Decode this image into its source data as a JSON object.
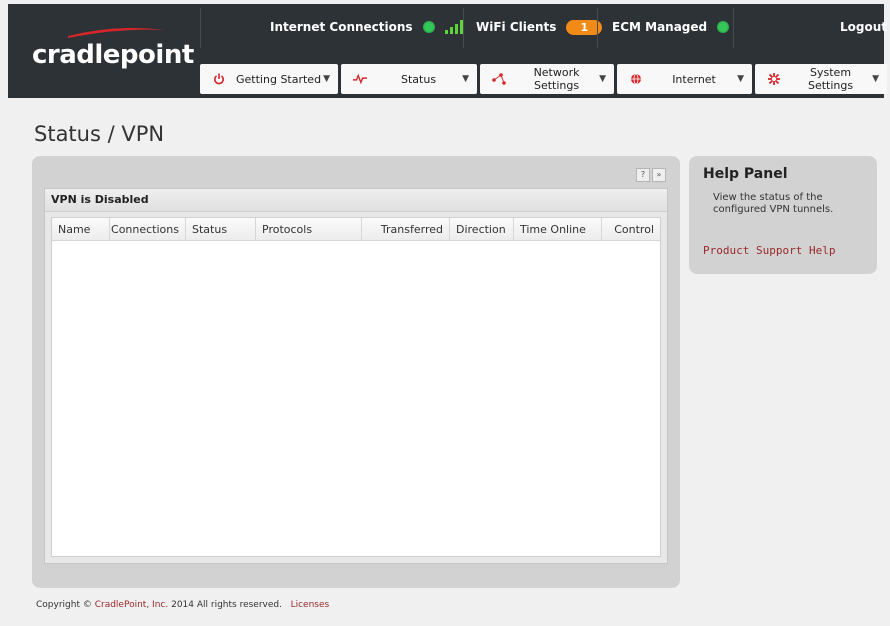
{
  "header": {
    "logo_text": "cradlepoint",
    "internet_connections_label": "Internet Connections",
    "wifi_clients_label": "WiFi Clients",
    "wifi_clients_count": "1",
    "ecm_managed_label": "ECM Managed",
    "logout_label": "Logout",
    "status_color": "#34c759",
    "badge_color": "#f28a18"
  },
  "nav": {
    "tabs": [
      {
        "label": "Getting Started",
        "icon": "power-icon"
      },
      {
        "label": "Status",
        "icon": "pulse-icon"
      },
      {
        "label": "Network Settings",
        "icon": "network-icon"
      },
      {
        "label": "Internet",
        "icon": "globe-icon"
      },
      {
        "label": "System Settings",
        "icon": "gear-icon"
      }
    ]
  },
  "page": {
    "title": "Status / VPN"
  },
  "grid": {
    "title": "VPN is Disabled",
    "help_btn": "?",
    "expand_btn": "»",
    "columns": [
      "Name",
      "Connections",
      "Status",
      "Protocols",
      "Transferred",
      "Direction",
      "Time Online",
      "Control"
    ]
  },
  "help": {
    "title": "Help Panel",
    "description": "View the status of the configured VPN tunnels.",
    "link": "Product Support Help"
  },
  "footer": {
    "copyright_prefix": "Copyright ©",
    "company": "CradlePoint, Inc.",
    "copyright_suffix": "2014 All rights reserved.",
    "licenses": "Licenses"
  }
}
